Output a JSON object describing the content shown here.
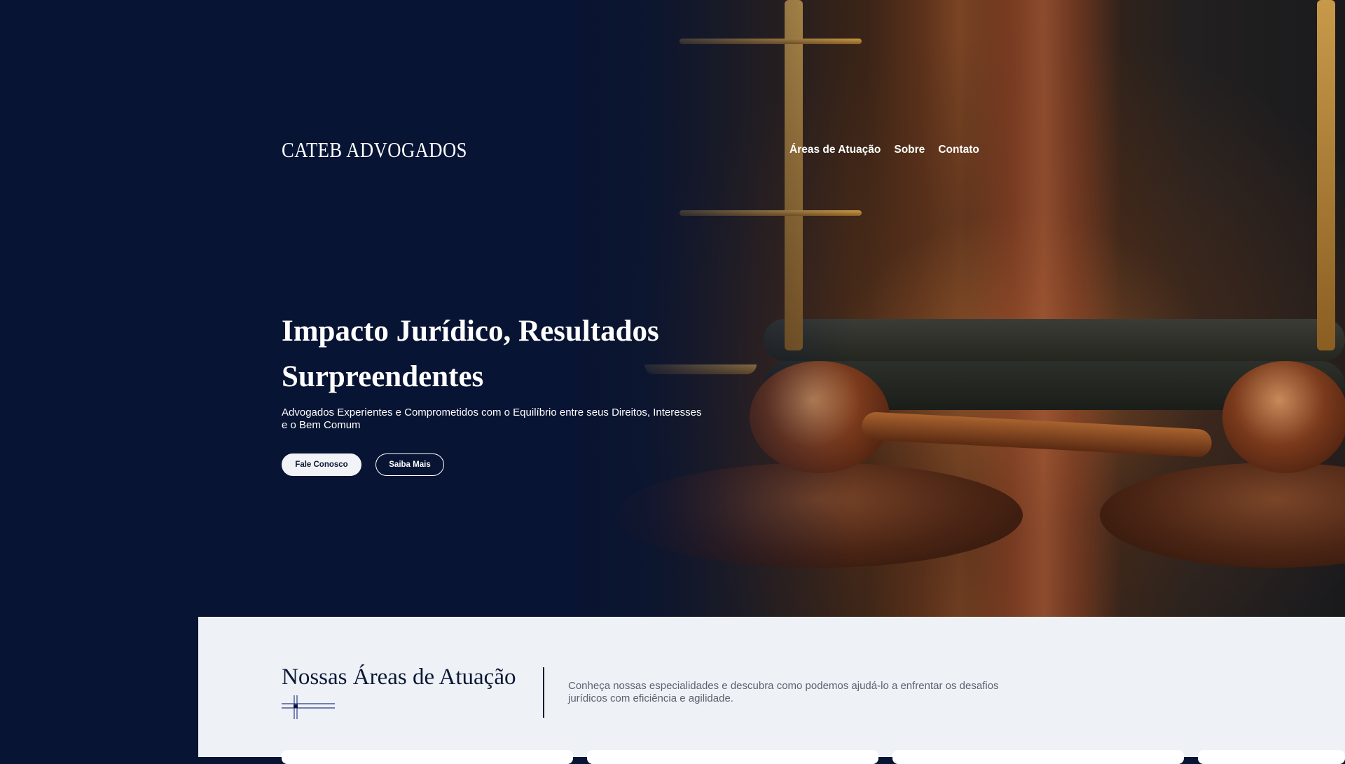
{
  "brand": {
    "logo_text": "CATEB ADVOGADOS"
  },
  "nav": {
    "items": [
      {
        "label": "Áreas de Atuação"
      },
      {
        "label": "Sobre"
      },
      {
        "label": "Contato"
      }
    ]
  },
  "hero": {
    "title": "Impacto Jurídico, Resultados Surpreendentes",
    "subtitle": "Advogados Experientes e Comprometidos com o Equilíbrio entre seus Direitos, Interesses e o Bem Comum",
    "primary_button": "Fale Conosco",
    "secondary_button": "Saiba Mais"
  },
  "areas": {
    "title": "Nossas Áreas de Atuação",
    "description": "Conheça nossas especialidades e descubra como podemos ajudá-lo a enfrentar os desafios jurídicos com eficiência e agilidade."
  },
  "colors": {
    "navy": "#081433",
    "light_section": "#eef1f5",
    "text_muted": "#5b6270",
    "button_light": "#f1f3f6"
  }
}
